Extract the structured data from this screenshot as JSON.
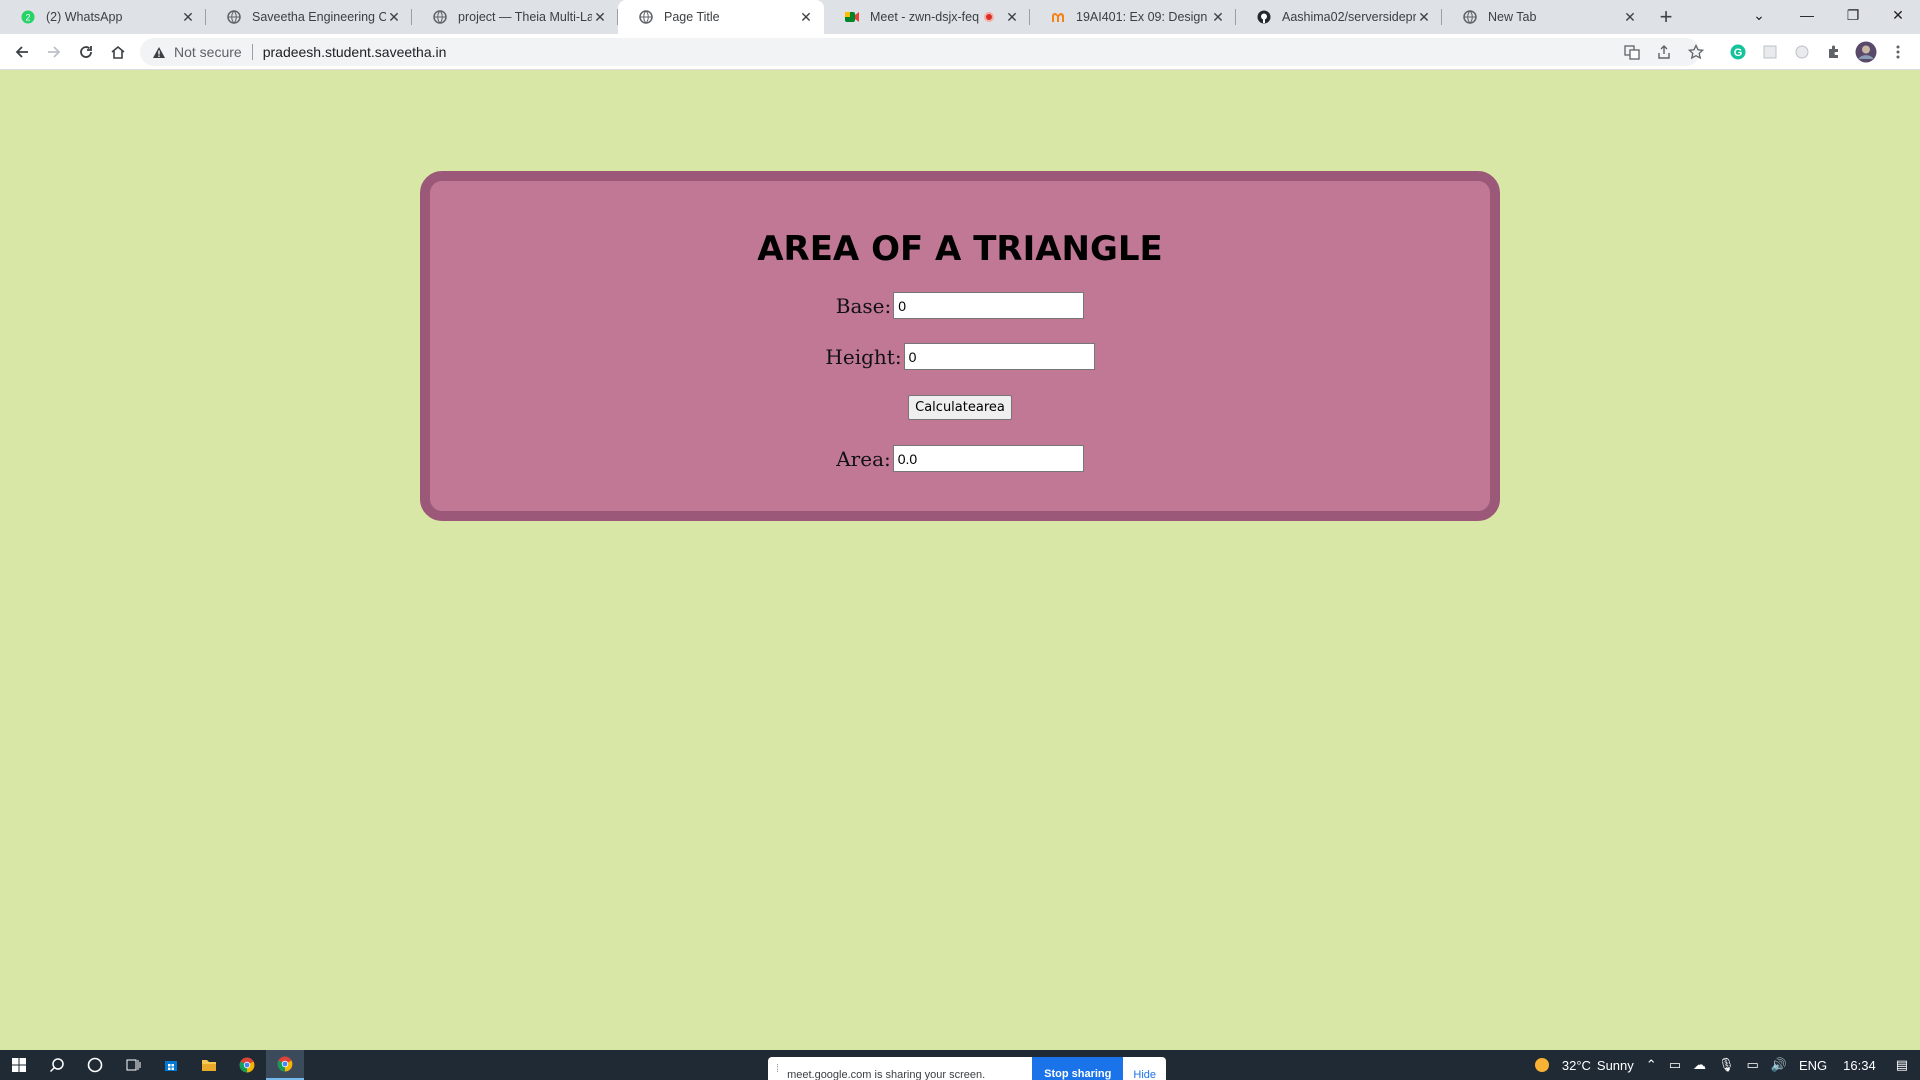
{
  "browser": {
    "tabs": [
      {
        "title": "(2) WhatsApp",
        "icon": "whatsapp-icon",
        "badge": "2"
      },
      {
        "title": "Saveetha Engineering Colle",
        "icon": "globe-icon"
      },
      {
        "title": "project — Theia Multi-Lan",
        "icon": "globe-icon"
      },
      {
        "title": "Page Title",
        "icon": "globe-icon",
        "active": true
      },
      {
        "title": "Meet - zwn-dsjx-feq",
        "icon": "meet-icon",
        "recording": true
      },
      {
        "title": "19AI401: Ex 09: Design a w",
        "icon": "moodle-icon"
      },
      {
        "title": "Aashima02/serversideproc",
        "icon": "github-icon"
      },
      {
        "title": "New Tab",
        "icon": "globe-icon"
      }
    ],
    "address": {
      "security": "Not secure",
      "url": "pradeesh.student.saveetha.in"
    }
  },
  "page": {
    "heading": "AREA OF A TRIANGLE",
    "base": {
      "label": "Base:",
      "value": "0"
    },
    "height": {
      "label": "Height:",
      "value": "0"
    },
    "button": "Calculatearea",
    "area": {
      "label": "Area:",
      "value": "0.0"
    }
  },
  "share_bar": {
    "message": "meet.google.com is sharing your screen.",
    "stop": "Stop sharing",
    "hide": "Hide"
  },
  "taskbar": {
    "weather_temp": "32°C",
    "weather_text": "Sunny",
    "lang": "ENG",
    "time": "16:34"
  },
  "colors": {
    "page_bg": "#d8e7a5",
    "card_bg": "#c17895",
    "card_border": "#9b5878"
  }
}
